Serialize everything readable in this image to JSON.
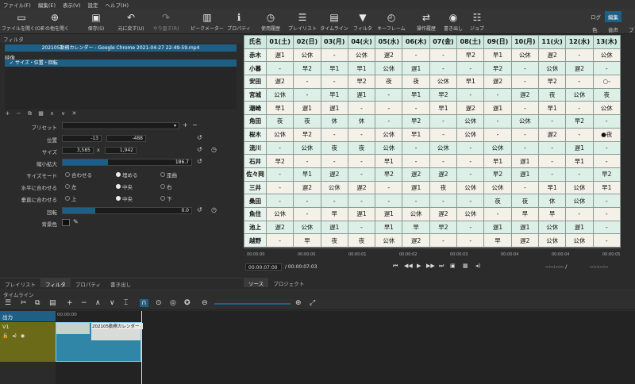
{
  "menu": [
    "ファイル(F)",
    "編集(E)",
    "表示(V)",
    "設定",
    "ヘルプ(H)"
  ],
  "toolbar": [
    {
      "label": "ファイルを開く(O)",
      "icon": "folder-icon"
    },
    {
      "label": "その他を開く",
      "icon": "open-other-icon"
    },
    {
      "label": "保存(S)",
      "icon": "save-icon"
    },
    {
      "label": "元に戻す(U)",
      "icon": "undo-icon"
    },
    {
      "label": "やり直す(R)",
      "icon": "redo-icon"
    },
    {
      "label": "ピークメーター",
      "icon": "peak-meter-icon"
    },
    {
      "label": "プロパティ",
      "icon": "info-icon"
    },
    {
      "label": "使用履歴",
      "icon": "history-icon"
    },
    {
      "label": "プレイリスト",
      "icon": "playlist-icon"
    },
    {
      "label": "タイムライン",
      "icon": "timeline-icon"
    },
    {
      "label": "フィルタ",
      "icon": "filter-icon"
    },
    {
      "label": "キーフレーム",
      "icon": "keyframe-icon"
    },
    {
      "label": "操作履歴",
      "icon": "jobs-history-icon"
    },
    {
      "label": "書き出し",
      "icon": "export-icon"
    },
    {
      "label": "ジョブ",
      "icon": "jobs-icon"
    }
  ],
  "layout_tabs": [
    "ログ",
    "編集"
  ],
  "layout_tabs_sub": [
    "色",
    "音声",
    "プ"
  ],
  "filters": {
    "title": "フィルタ",
    "clip_name": "202105勤務カレンダー - Google Chrome 2021-04-27 22-49-59.mp4",
    "section": "映像",
    "filter_item": "サイズ・位置・回転",
    "preset_label": "プリセット",
    "position_label": "位置",
    "pos_x": "-13",
    "pos_y": "-488",
    "size_label": "サイズ",
    "size_w": "3,585",
    "size_sep": "x",
    "size_h": "1,942",
    "zoom_label": "縮小拡大",
    "zoom_value": "186.7",
    "zoom_fill": 0.35,
    "sizemode_label": "サイズモード",
    "sizemode_opts": [
      "合わせる",
      "埋める",
      "歪曲"
    ],
    "halign_label": "水平に合わせる",
    "halign_opts": [
      "左",
      "中央",
      "右"
    ],
    "valign_label": "垂直に合わせる",
    "valign_opts": [
      "上",
      "中央",
      "下"
    ],
    "rotation_label": "回転",
    "rotation_value": "0.0",
    "rotation_fill": 0.25,
    "bgcolor_label": "背景色"
  },
  "calendar": {
    "headers": [
      "氏名",
      "01(土)",
      "02(日)",
      "03(月)",
      "04(火)",
      "05(水)",
      "06(木)",
      "07(金)",
      "08(土)",
      "09(日)",
      "10(月)",
      "11(火)",
      "12(水)",
      "13(木)"
    ],
    "rows": [
      [
        "赤木",
        "遅1",
        "公休",
        "-",
        "公休",
        "遅2",
        "-",
        "-",
        "早2",
        "早1",
        "公休",
        "遅2",
        "-",
        "公休"
      ],
      [
        "小暮",
        "-",
        "早2",
        "早1",
        "早1",
        "公休",
        "遅1",
        "-",
        "-",
        "早2",
        "-",
        "公休",
        "遅2",
        "-"
      ],
      [
        "安田",
        "遅2",
        "-",
        "-",
        "早2",
        "夜",
        "夜",
        "公休",
        "早1",
        "遅2",
        "-",
        "早2",
        "-",
        "○-"
      ],
      [
        "宮城",
        "公休",
        "-",
        "早1",
        "遅1",
        "-",
        "早1",
        "早2",
        "-",
        "-",
        "遅2",
        "夜",
        "公休",
        "夜"
      ],
      [
        "潮崎",
        "早1",
        "遅1",
        "遅1",
        "-",
        "-",
        "-",
        "早1",
        "遅2",
        "遅1",
        "-",
        "早1",
        "-",
        "公休"
      ],
      [
        "角田",
        "夜",
        "夜",
        "休",
        "休",
        "-",
        "早2",
        "-",
        "公休",
        "-",
        "公休",
        "-",
        "早2",
        "-"
      ],
      [
        "桜木",
        "公休",
        "早2",
        "-",
        "-",
        "公休",
        "早1",
        "-",
        "公休",
        "-",
        "-",
        "遅2",
        "-",
        "●夜"
      ],
      [
        "流川",
        "-",
        "公休",
        "夜",
        "夜",
        "公休",
        "-",
        "公休",
        "-",
        "公休",
        "-",
        "-",
        "遅1",
        "-"
      ],
      [
        "石井",
        "早2",
        "-",
        "-",
        "-",
        "早1",
        "-",
        "-",
        "-",
        "早1",
        "遅1",
        "-",
        "早1",
        "-"
      ],
      [
        "佐々岡",
        "-",
        "早1",
        "遅2",
        "-",
        "早2",
        "遅2",
        "遅2",
        "-",
        "早2",
        "遅1",
        "-",
        "-",
        "早2"
      ],
      [
        "三井",
        "-",
        "遅2",
        "公休",
        "遅2",
        "-",
        "遅1",
        "夜",
        "公休",
        "公休",
        "-",
        "早1",
        "公休",
        "早1"
      ],
      [
        "桑田",
        "-",
        "-",
        "-",
        "-",
        "-",
        "-",
        "-",
        "-",
        "夜",
        "夜",
        "休",
        "公休",
        "-"
      ],
      [
        "魚住",
        "公休",
        "-",
        "早",
        "遅1",
        "遅1",
        "公休",
        "遅2",
        "公休",
        "-",
        "早",
        "早",
        "-",
        "-"
      ],
      [
        "池上",
        "遅2",
        "公休",
        "遅1",
        "-",
        "早1",
        "早",
        "早2",
        "-",
        "遅1",
        "遅1",
        "公休",
        "遅1",
        "-"
      ],
      [
        "越野",
        "-",
        "早",
        "夜",
        "夜",
        "公休",
        "遅2",
        "-",
        "-",
        "早",
        "遅2",
        "公休",
        "公休",
        "-"
      ]
    ]
  },
  "ruler_ticks": [
    "00:00:00",
    "00:00:00",
    "00:00:01",
    "00:00:02",
    "00:00:03",
    "00:00:04",
    "00:00:04",
    "00:00:05"
  ],
  "transport": {
    "current": "00:00:07:00",
    "total": "/ 00:00:07:03",
    "in": "--:--:--:-- /",
    "out": "--:--:--:--"
  },
  "bottom_tabs": [
    "プレイリスト",
    "フィルタ",
    "プロパティ",
    "書き出し"
  ],
  "source_tabs": [
    "ソース",
    "プロジェクト"
  ],
  "timeline": {
    "title": "タイムライン",
    "output_label": "出力",
    "track_label": "V1",
    "clip_label": "202105勤務カレンダー -",
    "time_start": "00:00:00"
  }
}
